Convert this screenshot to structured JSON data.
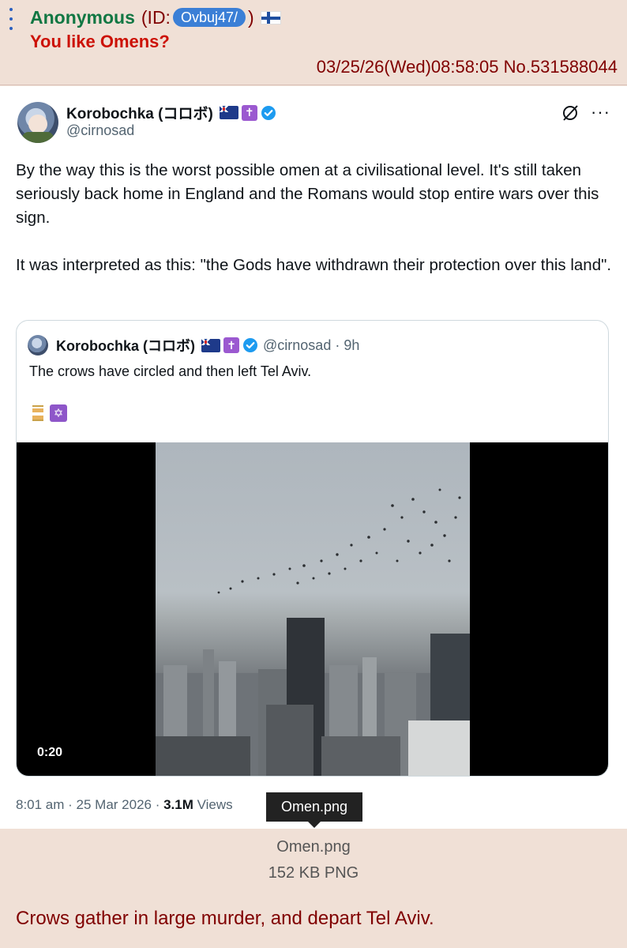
{
  "post": {
    "name": "Anonymous",
    "id_prefix": "(ID:",
    "id_value": "Ovbuj47/",
    "id_suffix": ")",
    "subject": "You like Omens?",
    "datetime_no": "03/25/26(Wed)08:58:05 No.531588044"
  },
  "tweet": {
    "author_name": "Korobochka (コロボ)",
    "handle": "@cirnosad",
    "paragraph_1": "By the way this is the worst possible omen at a civilisational level. It's still taken seriously back home in England and the Romans would stop entire wars over this sign.",
    "paragraph_2": "It was interpreted as this: \"the Gods have withdrawn their protection over this land\".",
    "quote": {
      "author_name": "Korobochka (コロボ)",
      "handle_time": "@cirnosad · 9h",
      "text": "The crows have circled and then left Tel Aviv.",
      "video_time": "0:20"
    },
    "time": "8:01 am · 25 Mar 2026 · ",
    "views_count": "3.1M",
    "views_label": " Views"
  },
  "tooltip": "Omen.png",
  "file": {
    "name": "Omen.png",
    "meta": "152 KB PNG"
  },
  "comment": "Crows gather in large murder, and depart Tel Aviv.",
  "colors": {
    "post_bg": "#f0e0d6",
    "name_green": "#117743",
    "subject_red": "#cc1105",
    "text_maroon": "#800000",
    "id_badge": "#3b7fd6",
    "verified_blue": "#1d9bf0"
  },
  "icons": [
    "post-menu-icon",
    "finland-flag-icon",
    "australia-flag-icon",
    "cross-icon",
    "verified-icon",
    "grok-icon",
    "more-icon",
    "hourglass-icon",
    "star-of-david-icon"
  ]
}
